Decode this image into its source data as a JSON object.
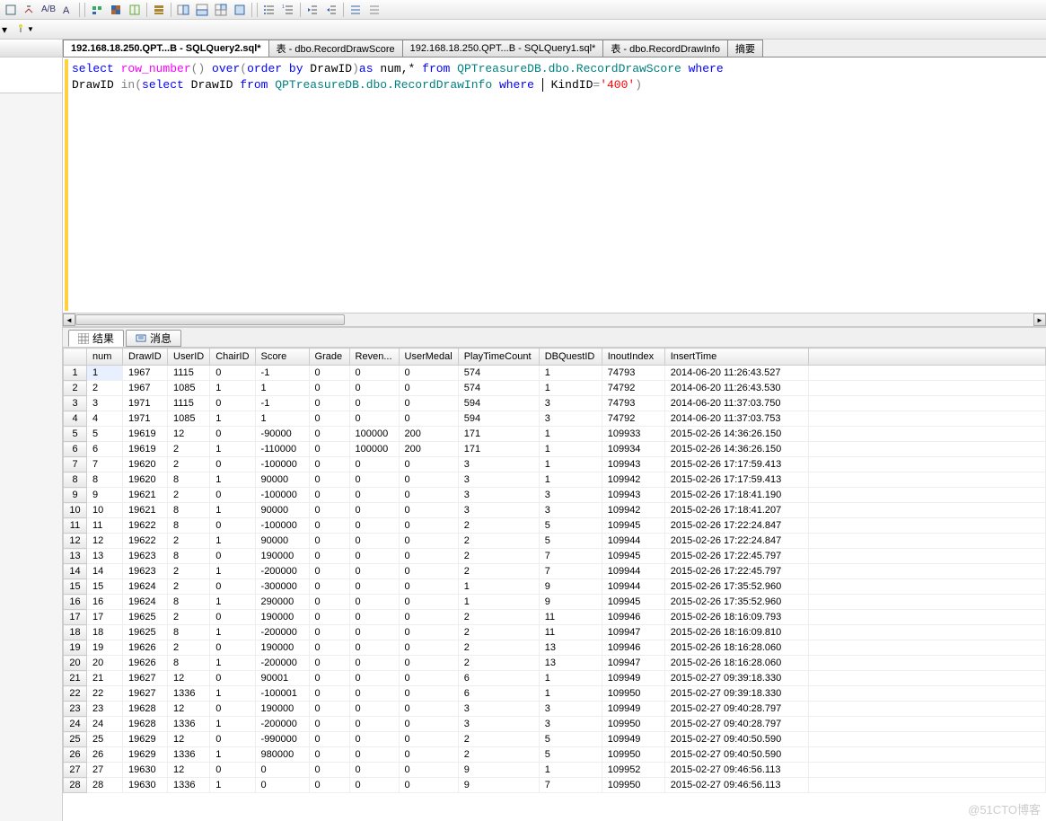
{
  "tabs": [
    {
      "label": "192.168.18.250.QPT...B - SQLQuery2.sql*",
      "active": true
    },
    {
      "label": "表 - dbo.RecordDrawScore",
      "active": false
    },
    {
      "label": "192.168.18.250.QPT...B - SQLQuery1.sql*",
      "active": false
    },
    {
      "label": "表 - dbo.RecordDrawInfo",
      "active": false
    },
    {
      "label": "摘要",
      "active": false
    }
  ],
  "sql": {
    "l1_select": "select",
    "l1_rownum": " row_number",
    "l1_p1": "()",
    "l1_over": " over",
    "l1_p2": "(",
    "l1_order": "order",
    "l1_by": " by",
    "l1_drawid": " DrawID",
    "l1_p3": ")",
    "l1_as": "as",
    "l1_rest": " num,* ",
    "l1_from": "from",
    "l1_tbl": " QPTreasureDB.dbo.RecordDrawScore ",
    "l1_where": "where",
    "l2_drawid": "DrawID ",
    "l2_in": "in",
    "l2_p1": "(",
    "l2_select": "select",
    "l2_drawid2": " DrawID ",
    "l2_from": "from",
    "l2_tbl": " QPTreasureDB.dbo.RecordDrawInfo ",
    "l2_where": "where",
    "l2_sp": " ",
    "l2_kindid": " KindID",
    "l2_eq": "=",
    "l2_val": "'400'",
    "l2_p2": ")"
  },
  "result_tabs": {
    "results": "结果",
    "messages": "消息"
  },
  "columns": [
    "",
    "num",
    "DrawID",
    "UserID",
    "ChairID",
    "Score",
    "Grade",
    "Reven...",
    "UserMedal",
    "PlayTimeCount",
    "DBQuestID",
    "InoutIndex",
    "InsertTime"
  ],
  "rows": [
    {
      "r": 1,
      "num": 1,
      "DrawID": 1967,
      "UserID": 1115,
      "ChairID": 0,
      "Score": -1,
      "Grade": 0,
      "Reven": 0,
      "UserMedal": 0,
      "PlayTimeCount": 574,
      "DBQuestID": 1,
      "InoutIndex": 74793,
      "InsertTime": "2014-06-20 11:26:43.527"
    },
    {
      "r": 2,
      "num": 2,
      "DrawID": 1967,
      "UserID": 1085,
      "ChairID": 1,
      "Score": 1,
      "Grade": 0,
      "Reven": 0,
      "UserMedal": 0,
      "PlayTimeCount": 574,
      "DBQuestID": 1,
      "InoutIndex": 74792,
      "InsertTime": "2014-06-20 11:26:43.530"
    },
    {
      "r": 3,
      "num": 3,
      "DrawID": 1971,
      "UserID": 1115,
      "ChairID": 0,
      "Score": -1,
      "Grade": 0,
      "Reven": 0,
      "UserMedal": 0,
      "PlayTimeCount": 594,
      "DBQuestID": 3,
      "InoutIndex": 74793,
      "InsertTime": "2014-06-20 11:37:03.750"
    },
    {
      "r": 4,
      "num": 4,
      "DrawID": 1971,
      "UserID": 1085,
      "ChairID": 1,
      "Score": 1,
      "Grade": 0,
      "Reven": 0,
      "UserMedal": 0,
      "PlayTimeCount": 594,
      "DBQuestID": 3,
      "InoutIndex": 74792,
      "InsertTime": "2014-06-20 11:37:03.753"
    },
    {
      "r": 5,
      "num": 5,
      "DrawID": 19619,
      "UserID": 12,
      "ChairID": 0,
      "Score": -90000,
      "Grade": 0,
      "Reven": 100000,
      "UserMedal": 200,
      "PlayTimeCount": 171,
      "DBQuestID": 1,
      "InoutIndex": 109933,
      "InsertTime": "2015-02-26 14:36:26.150"
    },
    {
      "r": 6,
      "num": 6,
      "DrawID": 19619,
      "UserID": 2,
      "ChairID": 1,
      "Score": -110000,
      "Grade": 0,
      "Reven": 100000,
      "UserMedal": 200,
      "PlayTimeCount": 171,
      "DBQuestID": 1,
      "InoutIndex": 109934,
      "InsertTime": "2015-02-26 14:36:26.150"
    },
    {
      "r": 7,
      "num": 7,
      "DrawID": 19620,
      "UserID": 2,
      "ChairID": 0,
      "Score": -100000,
      "Grade": 0,
      "Reven": 0,
      "UserMedal": 0,
      "PlayTimeCount": 3,
      "DBQuestID": 1,
      "InoutIndex": 109943,
      "InsertTime": "2015-02-26 17:17:59.413"
    },
    {
      "r": 8,
      "num": 8,
      "DrawID": 19620,
      "UserID": 8,
      "ChairID": 1,
      "Score": 90000,
      "Grade": 0,
      "Reven": 0,
      "UserMedal": 0,
      "PlayTimeCount": 3,
      "DBQuestID": 1,
      "InoutIndex": 109942,
      "InsertTime": "2015-02-26 17:17:59.413"
    },
    {
      "r": 9,
      "num": 9,
      "DrawID": 19621,
      "UserID": 2,
      "ChairID": 0,
      "Score": -100000,
      "Grade": 0,
      "Reven": 0,
      "UserMedal": 0,
      "PlayTimeCount": 3,
      "DBQuestID": 3,
      "InoutIndex": 109943,
      "InsertTime": "2015-02-26 17:18:41.190"
    },
    {
      "r": 10,
      "num": 10,
      "DrawID": 19621,
      "UserID": 8,
      "ChairID": 1,
      "Score": 90000,
      "Grade": 0,
      "Reven": 0,
      "UserMedal": 0,
      "PlayTimeCount": 3,
      "DBQuestID": 3,
      "InoutIndex": 109942,
      "InsertTime": "2015-02-26 17:18:41.207"
    },
    {
      "r": 11,
      "num": 11,
      "DrawID": 19622,
      "UserID": 8,
      "ChairID": 0,
      "Score": -100000,
      "Grade": 0,
      "Reven": 0,
      "UserMedal": 0,
      "PlayTimeCount": 2,
      "DBQuestID": 5,
      "InoutIndex": 109945,
      "InsertTime": "2015-02-26 17:22:24.847"
    },
    {
      "r": 12,
      "num": 12,
      "DrawID": 19622,
      "UserID": 2,
      "ChairID": 1,
      "Score": 90000,
      "Grade": 0,
      "Reven": 0,
      "UserMedal": 0,
      "PlayTimeCount": 2,
      "DBQuestID": 5,
      "InoutIndex": 109944,
      "InsertTime": "2015-02-26 17:22:24.847"
    },
    {
      "r": 13,
      "num": 13,
      "DrawID": 19623,
      "UserID": 8,
      "ChairID": 0,
      "Score": 190000,
      "Grade": 0,
      "Reven": 0,
      "UserMedal": 0,
      "PlayTimeCount": 2,
      "DBQuestID": 7,
      "InoutIndex": 109945,
      "InsertTime": "2015-02-26 17:22:45.797"
    },
    {
      "r": 14,
      "num": 14,
      "DrawID": 19623,
      "UserID": 2,
      "ChairID": 1,
      "Score": -200000,
      "Grade": 0,
      "Reven": 0,
      "UserMedal": 0,
      "PlayTimeCount": 2,
      "DBQuestID": 7,
      "InoutIndex": 109944,
      "InsertTime": "2015-02-26 17:22:45.797"
    },
    {
      "r": 15,
      "num": 15,
      "DrawID": 19624,
      "UserID": 2,
      "ChairID": 0,
      "Score": -300000,
      "Grade": 0,
      "Reven": 0,
      "UserMedal": 0,
      "PlayTimeCount": 1,
      "DBQuestID": 9,
      "InoutIndex": 109944,
      "InsertTime": "2015-02-26 17:35:52.960"
    },
    {
      "r": 16,
      "num": 16,
      "DrawID": 19624,
      "UserID": 8,
      "ChairID": 1,
      "Score": 290000,
      "Grade": 0,
      "Reven": 0,
      "UserMedal": 0,
      "PlayTimeCount": 1,
      "DBQuestID": 9,
      "InoutIndex": 109945,
      "InsertTime": "2015-02-26 17:35:52.960"
    },
    {
      "r": 17,
      "num": 17,
      "DrawID": 19625,
      "UserID": 2,
      "ChairID": 0,
      "Score": 190000,
      "Grade": 0,
      "Reven": 0,
      "UserMedal": 0,
      "PlayTimeCount": 2,
      "DBQuestID": 11,
      "InoutIndex": 109946,
      "InsertTime": "2015-02-26 18:16:09.793"
    },
    {
      "r": 18,
      "num": 18,
      "DrawID": 19625,
      "UserID": 8,
      "ChairID": 1,
      "Score": -200000,
      "Grade": 0,
      "Reven": 0,
      "UserMedal": 0,
      "PlayTimeCount": 2,
      "DBQuestID": 11,
      "InoutIndex": 109947,
      "InsertTime": "2015-02-26 18:16:09.810"
    },
    {
      "r": 19,
      "num": 19,
      "DrawID": 19626,
      "UserID": 2,
      "ChairID": 0,
      "Score": 190000,
      "Grade": 0,
      "Reven": 0,
      "UserMedal": 0,
      "PlayTimeCount": 2,
      "DBQuestID": 13,
      "InoutIndex": 109946,
      "InsertTime": "2015-02-26 18:16:28.060"
    },
    {
      "r": 20,
      "num": 20,
      "DrawID": 19626,
      "UserID": 8,
      "ChairID": 1,
      "Score": -200000,
      "Grade": 0,
      "Reven": 0,
      "UserMedal": 0,
      "PlayTimeCount": 2,
      "DBQuestID": 13,
      "InoutIndex": 109947,
      "InsertTime": "2015-02-26 18:16:28.060"
    },
    {
      "r": 21,
      "num": 21,
      "DrawID": 19627,
      "UserID": 12,
      "ChairID": 0,
      "Score": 90001,
      "Grade": 0,
      "Reven": 0,
      "UserMedal": 0,
      "PlayTimeCount": 6,
      "DBQuestID": 1,
      "InoutIndex": 109949,
      "InsertTime": "2015-02-27 09:39:18.330"
    },
    {
      "r": 22,
      "num": 22,
      "DrawID": 19627,
      "UserID": 1336,
      "ChairID": 1,
      "Score": -100001,
      "Grade": 0,
      "Reven": 0,
      "UserMedal": 0,
      "PlayTimeCount": 6,
      "DBQuestID": 1,
      "InoutIndex": 109950,
      "InsertTime": "2015-02-27 09:39:18.330"
    },
    {
      "r": 23,
      "num": 23,
      "DrawID": 19628,
      "UserID": 12,
      "ChairID": 0,
      "Score": 190000,
      "Grade": 0,
      "Reven": 0,
      "UserMedal": 0,
      "PlayTimeCount": 3,
      "DBQuestID": 3,
      "InoutIndex": 109949,
      "InsertTime": "2015-02-27 09:40:28.797"
    },
    {
      "r": 24,
      "num": 24,
      "DrawID": 19628,
      "UserID": 1336,
      "ChairID": 1,
      "Score": -200000,
      "Grade": 0,
      "Reven": 0,
      "UserMedal": 0,
      "PlayTimeCount": 3,
      "DBQuestID": 3,
      "InoutIndex": 109950,
      "InsertTime": "2015-02-27 09:40:28.797"
    },
    {
      "r": 25,
      "num": 25,
      "DrawID": 19629,
      "UserID": 12,
      "ChairID": 0,
      "Score": -990000,
      "Grade": 0,
      "Reven": 0,
      "UserMedal": 0,
      "PlayTimeCount": 2,
      "DBQuestID": 5,
      "InoutIndex": 109949,
      "InsertTime": "2015-02-27 09:40:50.590"
    },
    {
      "r": 26,
      "num": 26,
      "DrawID": 19629,
      "UserID": 1336,
      "ChairID": 1,
      "Score": 980000,
      "Grade": 0,
      "Reven": 0,
      "UserMedal": 0,
      "PlayTimeCount": 2,
      "DBQuestID": 5,
      "InoutIndex": 109950,
      "InsertTime": "2015-02-27 09:40:50.590"
    },
    {
      "r": 27,
      "num": 27,
      "DrawID": 19630,
      "UserID": 12,
      "ChairID": 0,
      "Score": 0,
      "Grade": 0,
      "Reven": 0,
      "UserMedal": 0,
      "PlayTimeCount": 9,
      "DBQuestID": 1,
      "InoutIndex": 109952,
      "InsertTime": "2015-02-27 09:46:56.113"
    },
    {
      "r": 28,
      "num": 28,
      "DrawID": 19630,
      "UserID": 1336,
      "ChairID": 1,
      "Score": 0,
      "Grade": 0,
      "Reven": 0,
      "UserMedal": 0,
      "PlayTimeCount": 9,
      "DBQuestID": 7,
      "InoutIndex": 109950,
      "InsertTime": "2015-02-27 09:46:56.113"
    }
  ],
  "watermark": "@51CTO博客"
}
